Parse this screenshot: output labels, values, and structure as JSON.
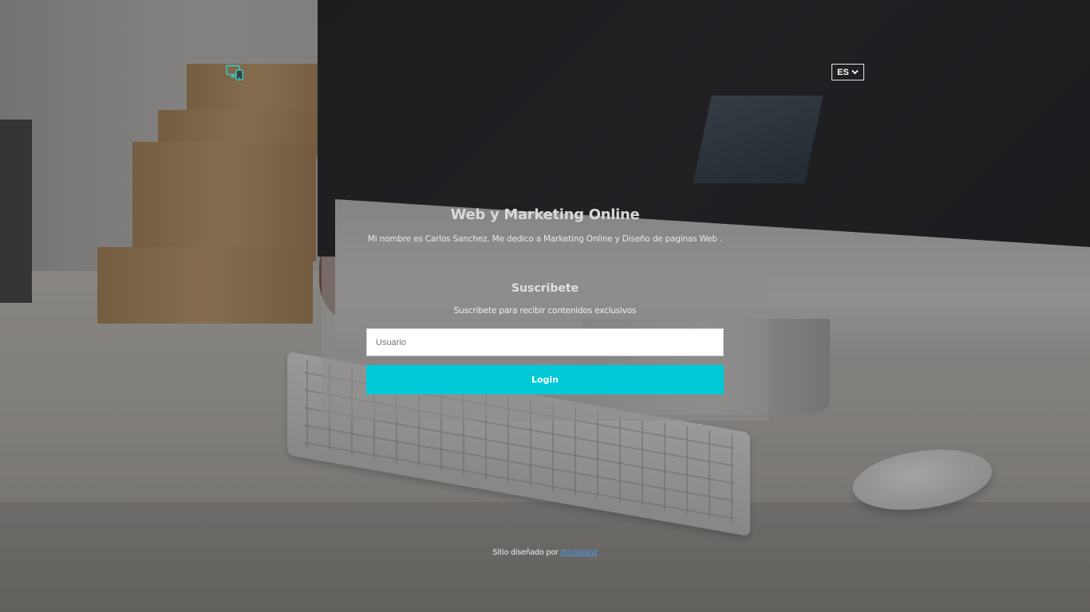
{
  "header": {
    "logo_icon": "devices-icon",
    "language": {
      "selected": "ES",
      "icon": "chevron-down-icon"
    }
  },
  "hero": {
    "title": "Web y Marketing Online",
    "subtitle": "Mi nombre es Carlos Sanchez. Me dedico a Marketing Online y Diseño de paginas Web ."
  },
  "subscribe": {
    "title": "Suscribete",
    "description": "Suscribete para recibir contenidos exclusivos",
    "username_placeholder": "Usuario",
    "username_value": "",
    "login_label": "Login"
  },
  "footer": {
    "text": "Sitio diseñado por ",
    "link_text": "@crissanz"
  },
  "colors": {
    "accent": "#00c9d7",
    "logo_icon": "#2fd0c8",
    "link": "#4a9be8"
  }
}
